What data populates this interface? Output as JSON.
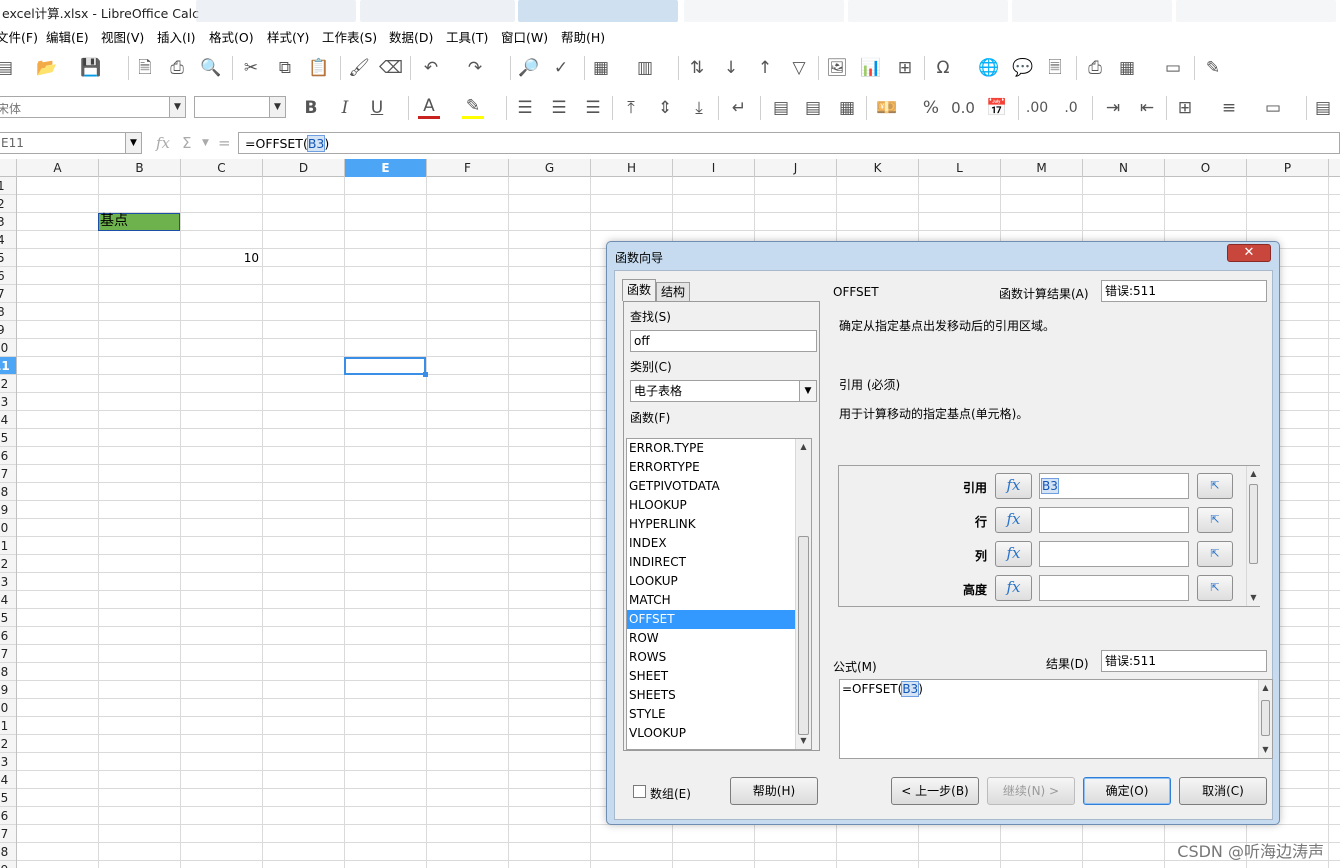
{
  "window": {
    "title": "excel计算.xlsx - LibreOffice Calc"
  },
  "menubar": [
    "文件(F)",
    "编辑(E)",
    "视图(V)",
    "插入(I)",
    "格式(O)",
    "样式(Y)",
    "工作表(S)",
    "数据(D)",
    "工具(T)",
    "窗口(W)",
    "帮助(H)"
  ],
  "toolbar2": {
    "font_name": "宋体",
    "font_size": ""
  },
  "formula_bar": {
    "name_box": "E11",
    "formula_prefix": "=OFFSET(",
    "formula_ref": "B3",
    "formula_suffix": ")"
  },
  "columns": [
    "A",
    "B",
    "C",
    "D",
    "E",
    "F",
    "G",
    "H",
    "I",
    "J",
    "K",
    "L",
    "M",
    "N",
    "O",
    "P"
  ],
  "selected_column": "E",
  "rows": [
    "1",
    "2",
    "3",
    "4",
    "5",
    "6",
    "7",
    "8",
    "9",
    "10",
    "11",
    "12",
    "13",
    "14",
    "15",
    "16",
    "17",
    "18",
    "19",
    "20",
    "21",
    "22",
    "23",
    "24",
    "25",
    "26",
    "27",
    "28",
    "29",
    "30",
    "31",
    "32",
    "33",
    "34",
    "35",
    "36",
    "37",
    "38",
    "39"
  ],
  "selected_row": "11",
  "cells": {
    "B3": "基点",
    "C5": "10"
  },
  "colors": {
    "selection_blue": "#4da5f5",
    "cell_b3_fill": "#6db24d",
    "list_highlight": "#3399ff"
  },
  "dialog": {
    "title": "函数向导",
    "close": "✕",
    "tabs": [
      "函数",
      "结构"
    ],
    "search_label": "查找(S)",
    "search_value": "off",
    "category_label": "类别(C)",
    "category_value": "电子表格",
    "function_label": "函数(F)",
    "functions": [
      "ERROR.TYPE",
      "ERRORTYPE",
      "GETPIVOTDATA",
      "HLOOKUP",
      "HYPERLINK",
      "INDEX",
      "INDIRECT",
      "LOOKUP",
      "MATCH",
      "OFFSET",
      "ROW",
      "ROWS",
      "SHEET",
      "SHEETS",
      "STYLE",
      "VLOOKUP"
    ],
    "selected_function": "OFFSET",
    "func_name": "OFFSET",
    "func_result_label": "函数计算结果(A)",
    "func_result_value": "错误:511",
    "func_desc": "确定从指定基点出发移动后的引用区域。",
    "arg_title": "引用 (必须)",
    "arg_desc": "用于计算移动的指定基点(单元格)。",
    "args": [
      {
        "label": "引用",
        "value": "B3"
      },
      {
        "label": "行",
        "value": ""
      },
      {
        "label": "列",
        "value": ""
      },
      {
        "label": "高度",
        "value": ""
      }
    ],
    "formula_label": "公式(M)",
    "result_label": "结果(D)",
    "result_value": "错误:511",
    "formula_prefix": "=OFFSET(",
    "formula_ref": "B3",
    "formula_suffix": ")",
    "array_label": "数组(E)",
    "buttons": {
      "help": "帮助(H)",
      "back": "< 上一步(B)",
      "next": "继续(N) >",
      "ok": "确定(O)",
      "cancel": "取消(C)"
    }
  },
  "watermark": "CSDN @听海边涛声"
}
